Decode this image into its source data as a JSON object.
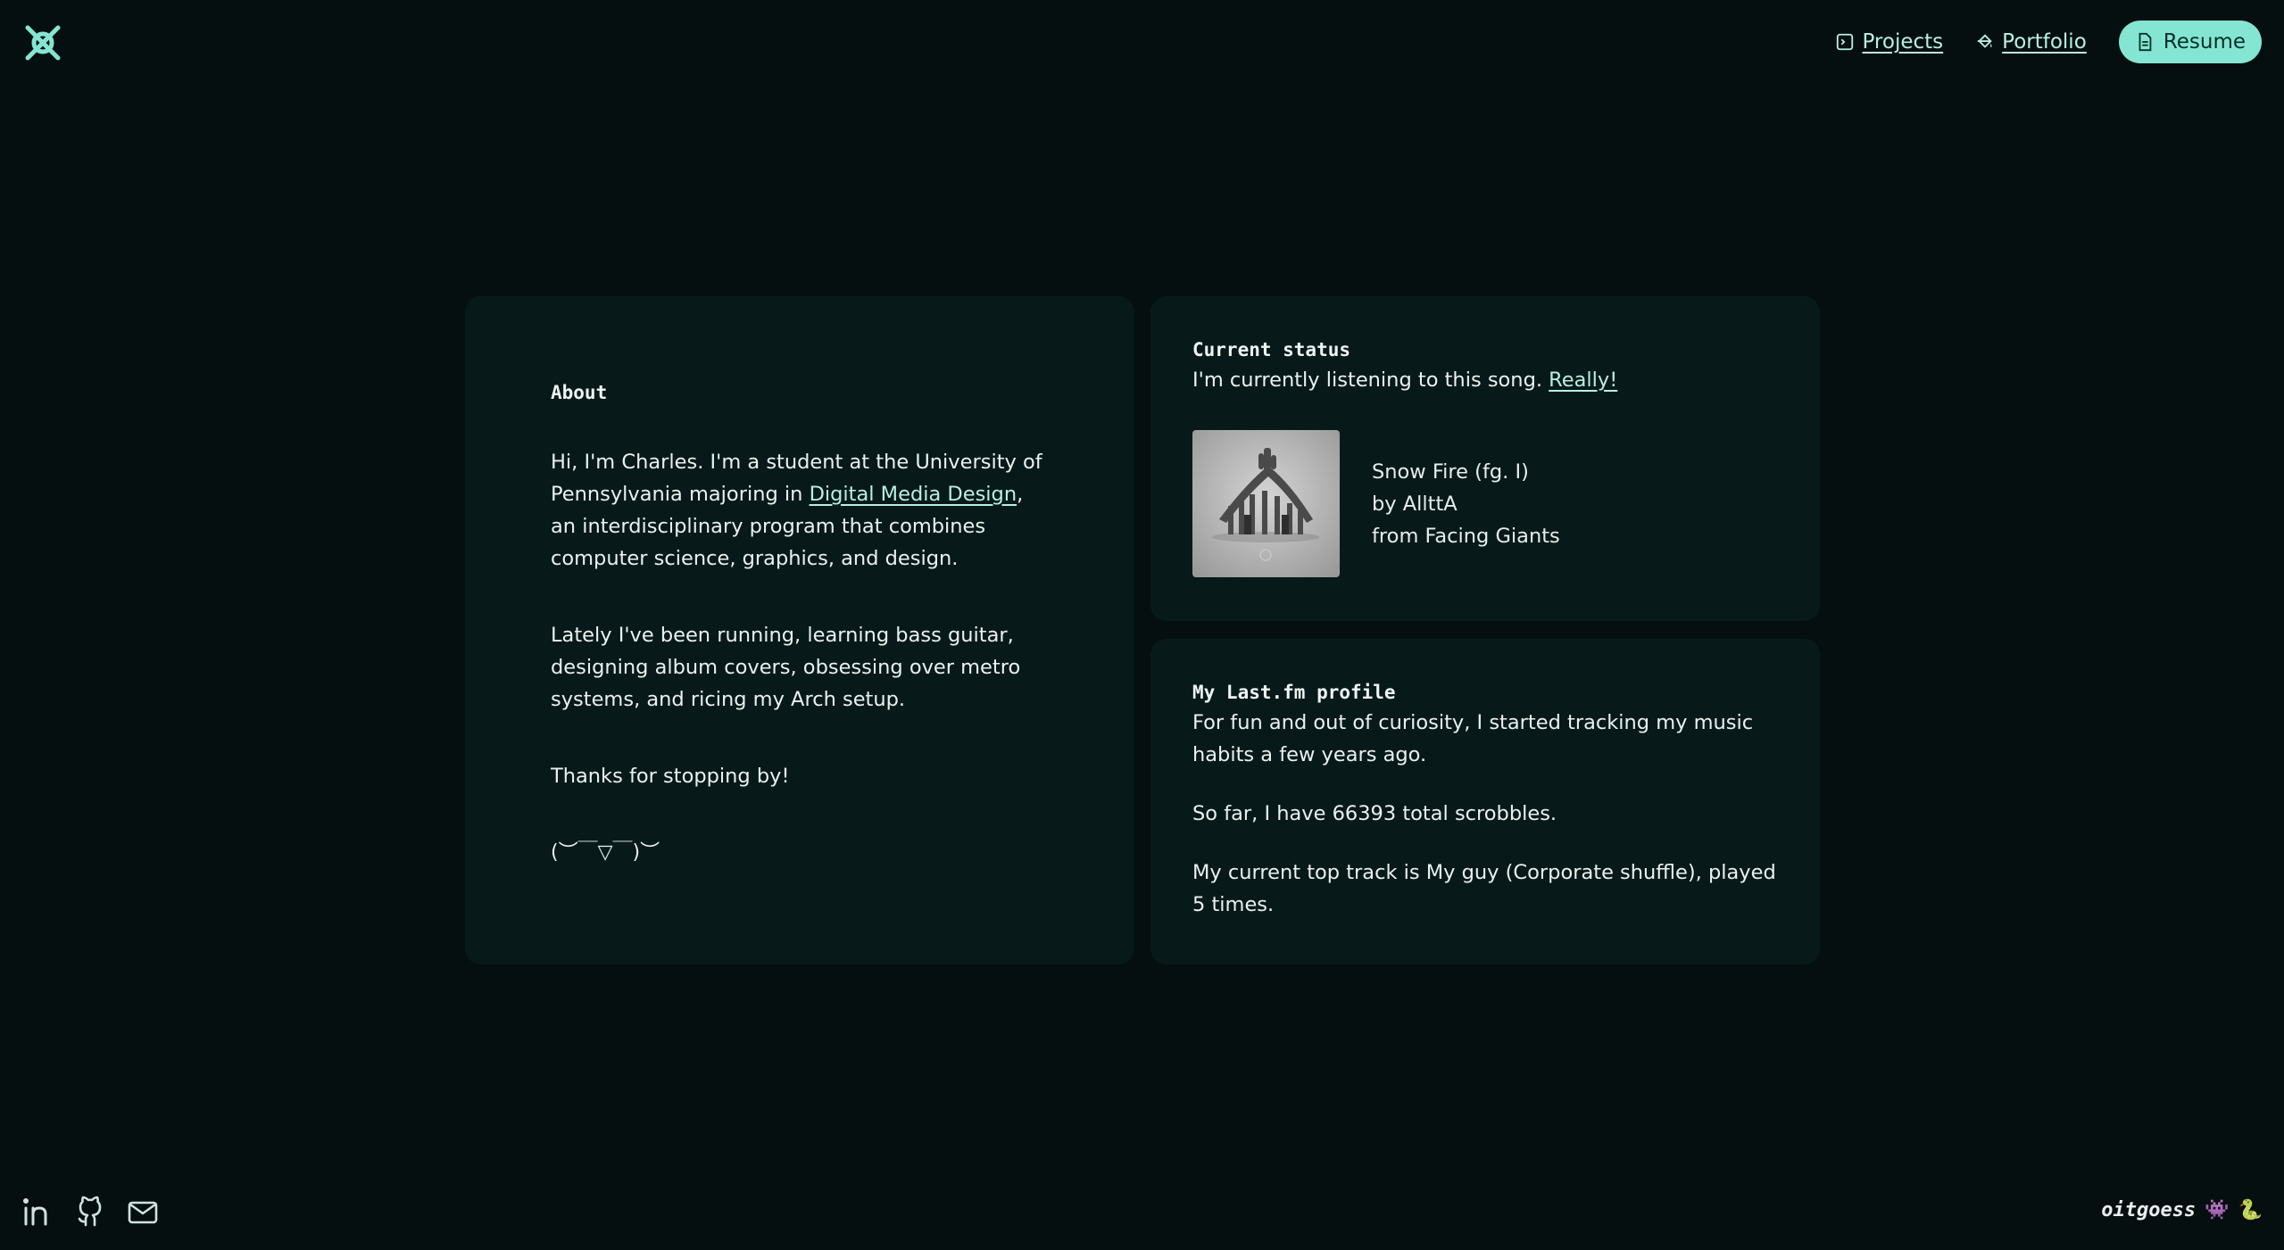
{
  "header": {
    "nav": [
      {
        "label": "Projects",
        "icon": "code-icon"
      },
      {
        "label": "Portfolio",
        "icon": "paint-bucket-icon"
      }
    ],
    "resume_label": "Resume"
  },
  "about": {
    "title": "About",
    "p1_before": "Hi, I'm Charles. I'm a student at the University of Pennsylvania majoring in ",
    "p1_link": "Digital Media Design",
    "p1_after": ", an interdisciplinary program that combines computer science, graphics, and design.",
    "p2": "Lately I've been running, learning bass guitar, designing album covers, obsessing over metro systems, and ricing my Arch setup.",
    "p3": "Thanks for stopping by!",
    "kaomoji": "(︶￣▽￣)︶"
  },
  "status": {
    "title": "Current status",
    "line_before": "I'm currently listening to this song. ",
    "line_link": "Really!",
    "track": {
      "name": "Snow Fire (fg. I)",
      "artist": "by AllttA",
      "album": "from Facing Giants"
    }
  },
  "lastfm": {
    "title": "My Last.fm profile",
    "p1": "For fun and out of curiosity, I started tracking my music habits a few years ago.",
    "p2": "So far, I have 66393 total scrobbles.",
    "p3": "My current top track is My guy (Corporate shuffle), played 5 times."
  },
  "footer": {
    "icons": [
      "linkedin-icon",
      "github-icon",
      "mail-icon"
    ],
    "signature": "oitgoess",
    "emojis": [
      "👾",
      "🐍"
    ]
  },
  "colors": {
    "background": "#050f0f",
    "card": "#071a19",
    "accent": "#84e6d2",
    "link": "#b8f0e2"
  }
}
